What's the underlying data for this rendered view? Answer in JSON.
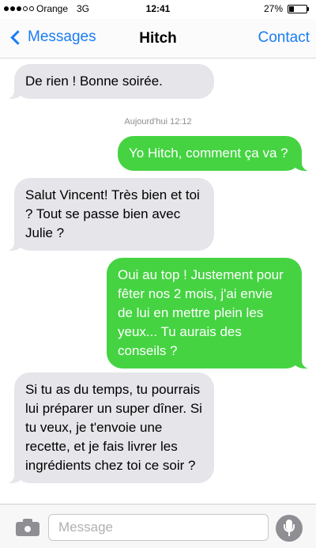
{
  "status_bar": {
    "carrier": "Orange",
    "network": "3G",
    "time": "12:41",
    "battery_percent": "27%",
    "battery_level": 0.27,
    "signal_bars_filled": 3,
    "signal_bars_total": 5
  },
  "nav": {
    "back_label": "Messages",
    "title": "Hitch",
    "contact_label": "Contact"
  },
  "thread": {
    "timestamp": "Aujourd'hui 12:12",
    "messages": [
      {
        "direction": "in",
        "text": "De rien ! Bonne soirée."
      },
      {
        "direction": "out",
        "text": "Yo Hitch, comment ça va ?"
      },
      {
        "direction": "in",
        "text": "Salut Vincent! Très bien et toi ? Tout se passe bien avec Julie ?"
      },
      {
        "direction": "out",
        "text": "Oui au top ! Justement pour fêter nos 2 mois, j'ai envie de lui en mettre plein les yeux... Tu aurais des conseils ?"
      },
      {
        "direction": "in",
        "text": "Si tu as du temps, tu pourrais lui préparer un super dîner. Si tu veux, je t'envoie une recette, et je fais livrer les ingrédients chez toi ce soir ?"
      }
    ]
  },
  "composer": {
    "placeholder": "Message",
    "camera_icon": "camera-icon",
    "mic_icon": "microphone-icon"
  },
  "colors": {
    "accent": "#1b7cf5",
    "outgoing_bubble": "#45d342",
    "incoming_bubble": "#e5e5ea"
  }
}
